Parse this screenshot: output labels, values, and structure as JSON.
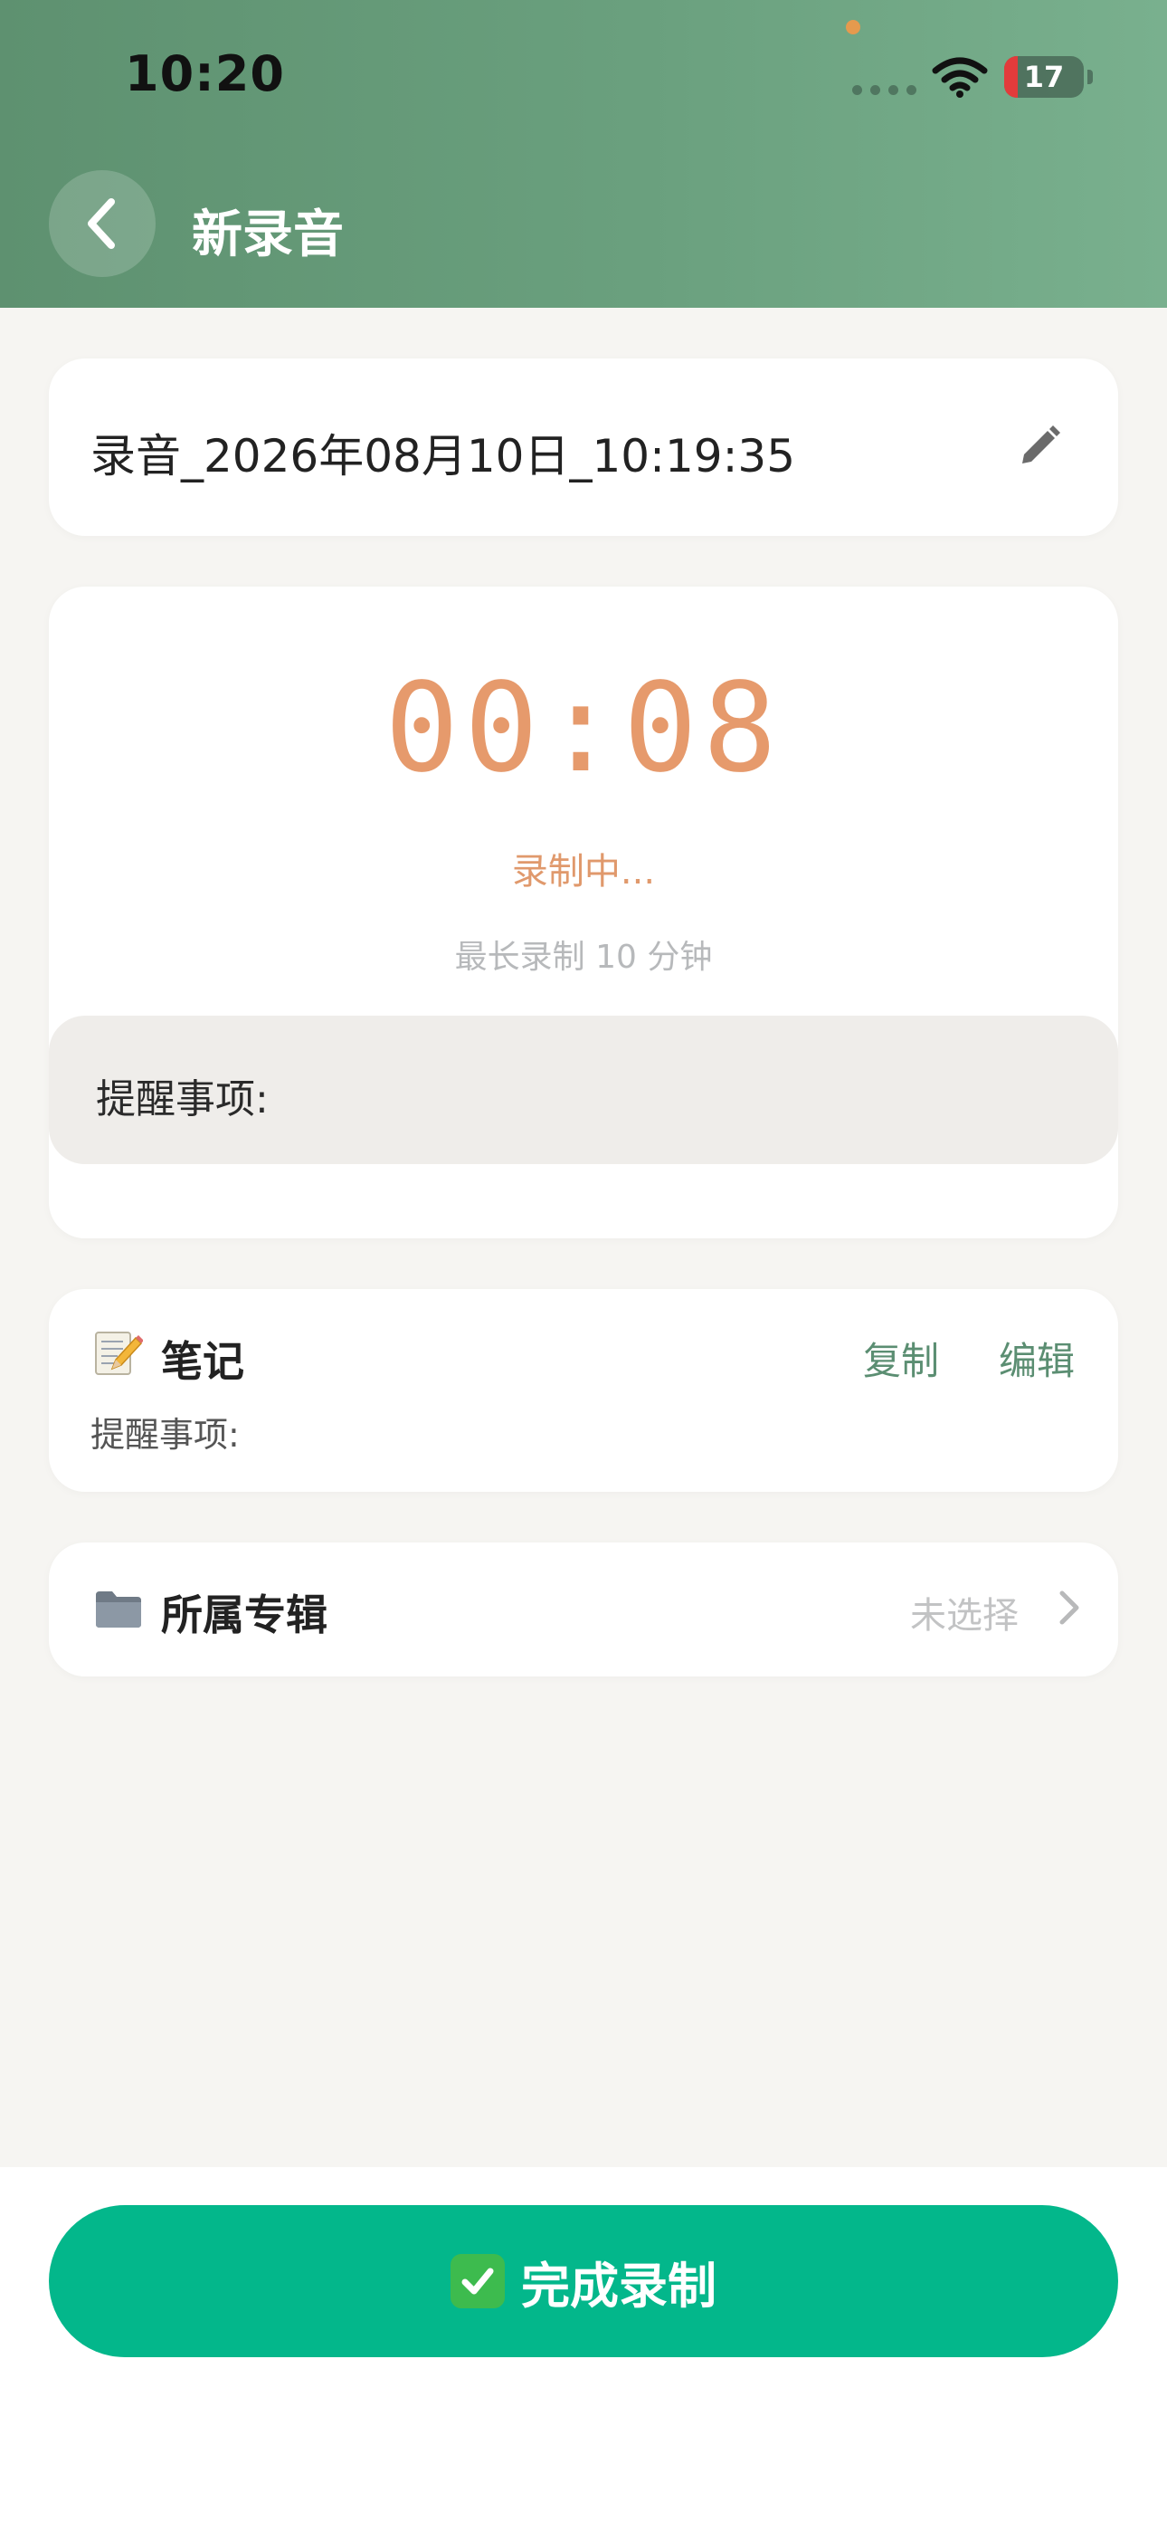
{
  "status_bar": {
    "time": "10:20",
    "battery_level": "17",
    "battery_fraction": 0.17
  },
  "header": {
    "title": "新录音",
    "back_icon": "chevron-left-icon"
  },
  "recording": {
    "name": "录音_2026年08月10日_10:19:35",
    "edit_icon": "pencil-icon",
    "timer": "00:08",
    "status": "录制中...",
    "max_duration": "最长录制 10 分钟",
    "reminder_label": "提醒事项:"
  },
  "notes": {
    "icon": "memo-emoji-icon",
    "title": "笔记",
    "copy_label": "复制",
    "edit_label": "编辑",
    "content": "提醒事项:"
  },
  "album": {
    "icon": "folder-icon",
    "title": "所属专辑",
    "value": "未选择",
    "chevron_icon": "chevron-right-icon"
  },
  "footer": {
    "finish_label": "完成录制",
    "finish_icon": "check-mark-button-icon"
  },
  "colors": {
    "header_start": "#5e9170",
    "header_end": "#79b08e",
    "accent_green": "#5b8e72",
    "timer_orange": "#e69a6c",
    "primary_button": "#03b78b",
    "background": "#f6f5f2"
  }
}
